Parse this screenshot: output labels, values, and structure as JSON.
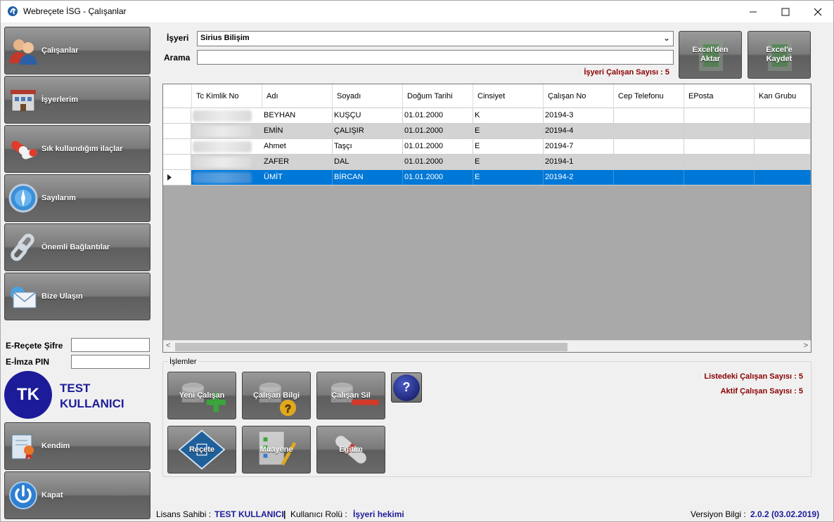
{
  "window": {
    "title": "Webreçete İSG - Çalışanlar",
    "min_icon": "minimize-icon",
    "max_icon": "maximize-icon",
    "close_icon": "close-icon"
  },
  "sidebar": {
    "items": [
      {
        "label": "Çalışanlar",
        "icon": "people-icon"
      },
      {
        "label": "İşyerlerim",
        "icon": "building-icon"
      },
      {
        "label": "Sık kullandığım ilaçlar",
        "icon": "pills-icon"
      },
      {
        "label": "Sayılarım",
        "icon": "compass-icon"
      },
      {
        "label": "Önemli Bağlantılar",
        "icon": "chain-link-icon"
      },
      {
        "label": "Bize Ulaşın",
        "icon": "envelope-icon"
      }
    ],
    "ereceete_label": "E-Reçete Şifre",
    "eimza_label": "E-İmza PIN",
    "avatar_initials": "TK",
    "user_name": "TEST KULLANICI",
    "kendim_label": "Kendim",
    "kapat_label": "Kapat"
  },
  "main": {
    "isyeri_label": "İşyeri",
    "isyeri_value": "Sirius Bilişim",
    "arama_label": "Arama",
    "isyeri_count": "İşyeri Çalışan Sayısı : 5",
    "excel_import_label": "Excel'den Aktar",
    "excel_save_label": "Excel'e Kaydet"
  },
  "grid": {
    "columns": [
      "Tc Kimlik No",
      "Adı",
      "Soyadı",
      "Doğum Tarihi",
      "Cinsiyet",
      "Çalışan No",
      "Cep Telefonu",
      "EPosta",
      "Kan Grubu"
    ],
    "rows": [
      {
        "adi": "BEYHAN",
        "soyadi": "KUŞÇU",
        "dogum": "01.01.2000",
        "cinsiyet": "K",
        "no": "20194-3"
      },
      {
        "adi": "EMİN",
        "soyadi": "ÇALIŞIR",
        "dogum": "01.01.2000",
        "cinsiyet": "E",
        "no": "20194-4"
      },
      {
        "adi": "Ahmet",
        "soyadi": "Taşçı",
        "dogum": "01.01.2000",
        "cinsiyet": "E",
        "no": "20194-7"
      },
      {
        "adi": "ZAFER",
        "soyadi": "DAL",
        "dogum": "01.01.2000",
        "cinsiyet": "E",
        "no": "20194-1"
      },
      {
        "adi": "ÜMİT",
        "soyadi": "BİRCAN",
        "dogum": "01.01.2000",
        "cinsiyet": "E",
        "no": "20194-2"
      }
    ],
    "selected_row": 4
  },
  "ops": {
    "title": "İşlemler",
    "yeni": "Yeni Çalışan",
    "bilgi": "Çalışan Bilgi",
    "sil": "Çalışan Sil",
    "help": "?",
    "recete": "Reçete",
    "muayene": "Muayene",
    "egitim": "Eğitim",
    "listed_count": "Listedeki Çalışan Sayısı : 5",
    "active_count": "Aktif Çalışan Sayısı : 5"
  },
  "status": {
    "lisans_label": "Lisans Sahibi :",
    "lisans_value": "TEST KULLANICI",
    "sep": "|",
    "rol_label": "Kullanıcı Rolü :",
    "rol_value": "İşyeri hekimi",
    "versiyon_label": "Versiyon Bilgi :",
    "versiyon_value": "2.0.2 (03.02.2019)"
  },
  "colors": {
    "accent": "#0078d7",
    "count_red": "#8b0000",
    "user_blue": "#1c1c9a"
  }
}
